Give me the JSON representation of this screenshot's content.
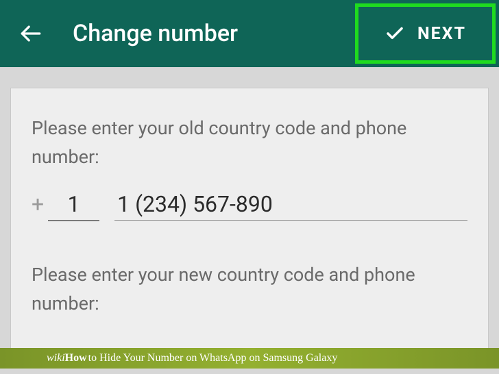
{
  "header": {
    "title": "Change number",
    "next_label": "NEXT"
  },
  "form": {
    "old_prompt": "Please enter your old country code and phone number:",
    "old_country_code": "1",
    "old_phone_number": "1 (234) 567-890",
    "new_prompt": "Please enter your new country code and phone number:",
    "plus_sign": "+"
  },
  "footer": {
    "wiki": "wiki",
    "how": "How",
    "article_title": " to Hide Your Number on WhatsApp on Samsung Galaxy"
  }
}
